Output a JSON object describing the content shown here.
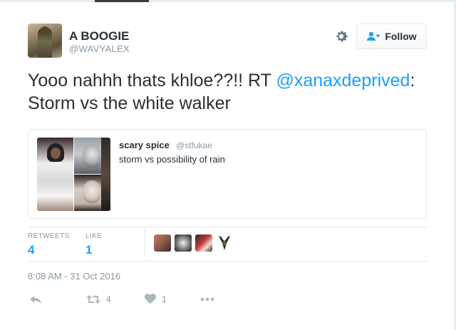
{
  "user": {
    "name": "A BOOGIE",
    "handle": "@WAVYALEX",
    "follow_label": "Follow"
  },
  "tweet": {
    "text_before": "Yooo nahhh thats khloe??!!  RT ",
    "mention": "@xanaxdeprived",
    "text_after": ": Storm vs the white walker",
    "timestamp": "8:08 AM - 31 Oct 2016"
  },
  "quote": {
    "name": "scary spice",
    "handle": "@stfukae",
    "text": "storm vs possibility of rain"
  },
  "stats": {
    "retweets_label": "RETWEETS",
    "retweets_value": "4",
    "likes_label": "LIKE",
    "likes_value": "1"
  },
  "actions": {
    "retweet_count": "4",
    "like_count": "1"
  },
  "colors": {
    "accent": "#1da1f2",
    "text": "#292f33",
    "muted": "#8899a6",
    "border": "#e1e8ed"
  },
  "icons": [
    "gear-icon",
    "follow-person-icon",
    "reply-icon",
    "retweet-icon",
    "heart-icon",
    "more-icon"
  ]
}
